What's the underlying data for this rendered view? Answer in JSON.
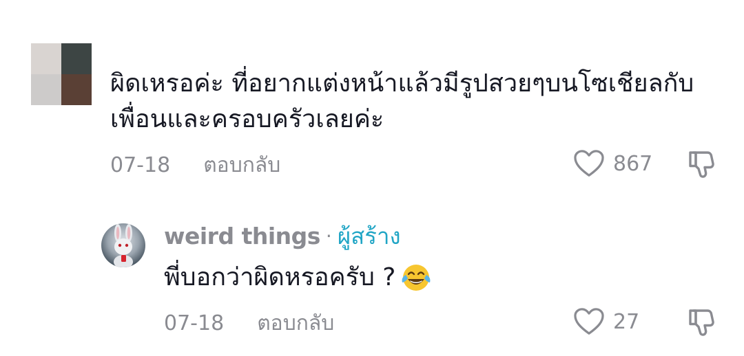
{
  "comment": {
    "text": "ผิดเหรอค่ะ ที่อยากแต่งหน้าแล้วมีรูปสวยๆบนโซเชียลกับเพื่อนและครอบครัวเลยค่ะ",
    "date": "07-18",
    "reply_label": "ตอบกลับ",
    "like_count": "867",
    "avatar_colors": [
      "#d9d4d1",
      "#3d4544",
      "#cdcbca",
      "#5a4035"
    ]
  },
  "reply": {
    "username": "weird things",
    "separator": "·",
    "creator_label": "ผู้สร้าง",
    "text": "พี่บอกว่าผิดหรอครับ ?",
    "emoji": "face-with-tears-of-joy",
    "date": "07-18",
    "reply_label": "ตอบกลับ",
    "like_count": "27"
  },
  "colors": {
    "meta_gray": "#8a8b91",
    "creator_accent": "#20a5c5",
    "text": "#161823"
  }
}
